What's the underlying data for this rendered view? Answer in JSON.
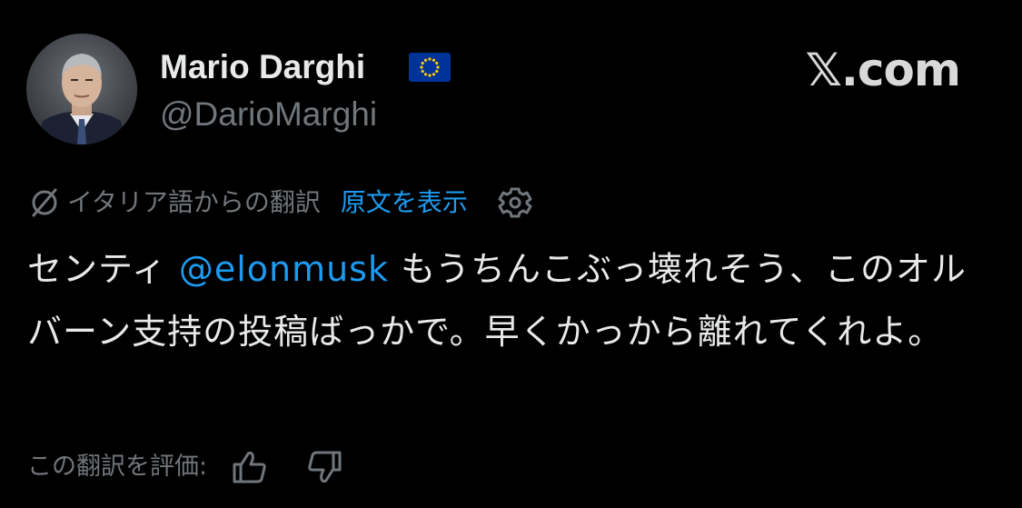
{
  "author": {
    "display_name": "Mario Darghi",
    "handle": "@DarioMarghi",
    "verified_badge": "eu-flag-icon"
  },
  "site": {
    "label": "𝕏.com"
  },
  "translation": {
    "from_label": "イタリア語からの翻訳",
    "show_original_label": "原文を表示"
  },
  "tweet": {
    "text_before": "センティ ",
    "mention": "@elonmusk",
    "text_after": " もうちんこぶっ壊れそう、このオルバーン支持の投稿ばっかで。早くかっから離れてくれよ。"
  },
  "rating": {
    "label": "この翻訳を評価:"
  },
  "colors": {
    "background": "#000000",
    "text_primary": "#e7e9ea",
    "text_secondary": "#71767b",
    "link": "#1d9bf0",
    "eu_blue": "#003399",
    "eu_gold": "#ffcc00"
  }
}
